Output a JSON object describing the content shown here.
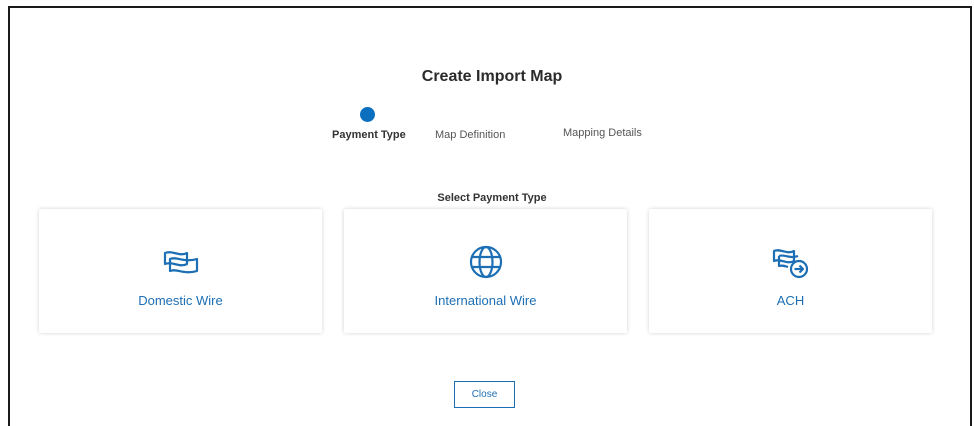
{
  "dialog": {
    "title": "Create Import Map"
  },
  "stepper": {
    "active_index": 0,
    "steps": [
      {
        "label": "Payment Type",
        "active": true
      },
      {
        "label": "Map Definition",
        "active": false
      },
      {
        "label": "Mapping Details",
        "active": false
      }
    ],
    "active_color": "#0b6fbf"
  },
  "selection": {
    "heading": "Select Payment Type",
    "options": [
      {
        "label": "Domestic Wire",
        "icon": "banknote-icon"
      },
      {
        "label": "International Wire",
        "icon": "globe-icon"
      },
      {
        "label": "ACH",
        "icon": "banknote-arrow-icon"
      }
    ],
    "accent_color": "#1c6fb5"
  },
  "footer": {
    "close_label": "Close"
  }
}
